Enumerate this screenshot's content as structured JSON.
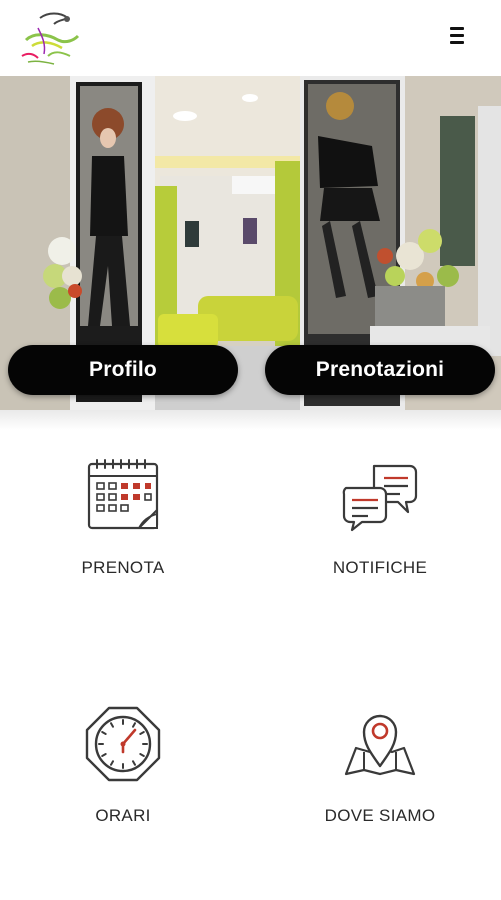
{
  "header": {
    "logo_alt": "Salon logo",
    "menu_icon": "hamburger-menu-icon"
  },
  "hero": {
    "buttons": [
      {
        "label": "Profilo"
      },
      {
        "label": "Prenotazioni"
      }
    ]
  },
  "tiles": [
    {
      "label": "PRENOTA",
      "icon": "calendar-icon"
    },
    {
      "label": "NOTIFICHE",
      "icon": "chat-bubbles-icon"
    },
    {
      "label": "ORARI",
      "icon": "clock-icon"
    },
    {
      "label": "DOVE SIAMO",
      "icon": "map-pin-icon"
    }
  ],
  "colors": {
    "icon_stroke": "#3a3a3a",
    "icon_accent": "#c0392b",
    "pill_bg": "#050505",
    "pill_text": "#ffffff"
  }
}
